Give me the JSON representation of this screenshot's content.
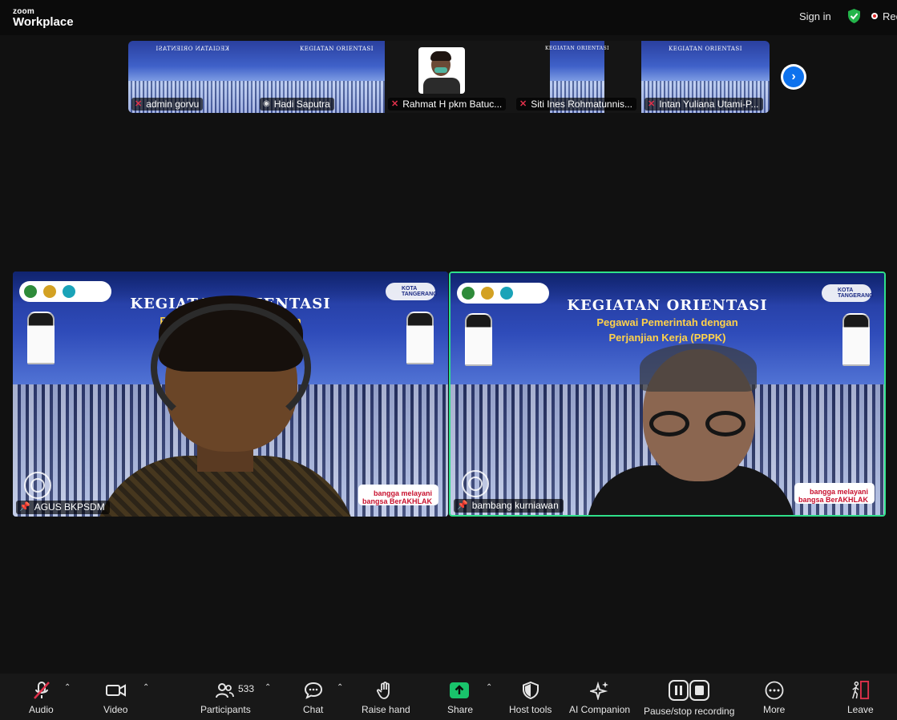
{
  "app": {
    "brand_small": "zoom",
    "brand_big": "Workplace"
  },
  "topbar": {
    "sign_in": "Sign in",
    "recording": "Recording"
  },
  "thumbnails": [
    {
      "name": "admin gorvu",
      "muted": true,
      "slide_title": "KEGIATAN ORIENTASI"
    },
    {
      "name": "Hadi Saputra",
      "muted": false,
      "slide_title": "KEGIATAN ORIENTASI"
    },
    {
      "name": "Rahmat H pkm Batuc...",
      "muted": true
    },
    {
      "name": "Siti Ines Rohmatunnis...",
      "muted": true,
      "slide_title": "KEGIATAN ORIENTASI"
    },
    {
      "name": "Intan Yuliana Utami-P...",
      "muted": true,
      "slide_title": "KEGIATAN ORIENTASI"
    }
  ],
  "slide": {
    "title": "KEGIATAN ORIENTASI",
    "sub1": "Pegawai Pemerintah dengan",
    "sub2": "Perjanjian Kerja (PPPK)",
    "kota": "KOTA TANGERANG",
    "badge": "bangga melayani bangsa BerAKHLAK"
  },
  "tiles": [
    {
      "name": "AGUS BKPSDM",
      "active": false
    },
    {
      "name": "bambang kurniawan",
      "active": true
    }
  ],
  "toolbar": {
    "audio": "Audio",
    "video": "Video",
    "participants": "Participants",
    "participants_count": "533",
    "chat": "Chat",
    "raise_hand": "Raise hand",
    "share": "Share",
    "host_tools": "Host tools",
    "ai_companion": "AI Companion",
    "pause_stop": "Pause/stop recording",
    "more": "More",
    "leave": "Leave"
  },
  "colors": {
    "accent_green": "#2fe08a",
    "share_green": "#19c36b",
    "blue": "#0e72ed",
    "mute_red": "#e0314b"
  }
}
